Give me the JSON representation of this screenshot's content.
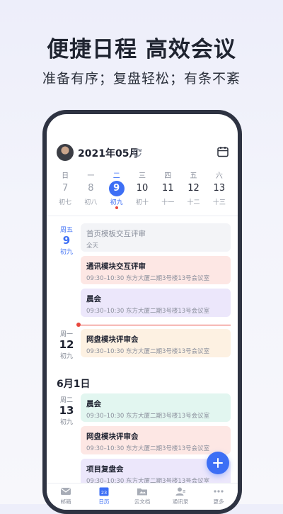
{
  "promo": {
    "headline": "便捷日程 高效会议",
    "subline": "准备有序；复盘轻松；有条不紊"
  },
  "header": {
    "month": "2021年05月"
  },
  "week": [
    {
      "weekday": "日",
      "day": "7",
      "lunar": "初七"
    },
    {
      "weekday": "一",
      "day": "8",
      "lunar": "初八"
    },
    {
      "weekday": "二",
      "day": "9",
      "lunar": "初九"
    },
    {
      "weekday": "三",
      "day": "10",
      "lunar": "初十"
    },
    {
      "weekday": "四",
      "day": "11",
      "lunar": "十一"
    },
    {
      "weekday": "五",
      "day": "12",
      "lunar": "十二"
    },
    {
      "weekday": "六",
      "day": "13",
      "lunar": "十三"
    }
  ],
  "groups": [
    {
      "weekday": "周五",
      "day": "9",
      "lunar": "初九"
    },
    {
      "weekday": "周一",
      "day": "12",
      "lunar": "初九"
    },
    {
      "weekday": "周二",
      "day": "13",
      "lunar": "初九"
    }
  ],
  "section_date": "6月1日",
  "events": [
    {
      "title": "首页模板交互评审",
      "sub": "全天"
    },
    {
      "title": "通讯模块交互评审",
      "sub": "09:30–10:30  东方大厦二期3号楼13号会议室"
    },
    {
      "title": "晨会",
      "sub": "09:30–10:30  东方大厦二期3号楼13号会议室"
    },
    {
      "title": "网盘模块评审会",
      "sub": "09:30–10:30  东方大厦二期3号楼13号会议室"
    },
    {
      "title": "晨会",
      "sub": "09:30–10:30  东方大厦二期3号楼13号会议室"
    },
    {
      "title": "网盘模块评审会",
      "sub": "09:30–10:30  东方大厦二期3号楼13号会议室"
    },
    {
      "title": "项目复盘会",
      "sub": "09:30–10:30  东方大厦二期3号楼13号会议室"
    }
  ],
  "tabs": [
    {
      "label": "邮箱",
      "icon": "mail-icon"
    },
    {
      "label": "日历",
      "icon": "calendar-icon",
      "badge": "23"
    },
    {
      "label": "云文档",
      "icon": "folder-icon"
    },
    {
      "label": "通讯录",
      "icon": "contacts-icon"
    },
    {
      "label": "更多",
      "icon": "more-icon"
    }
  ],
  "colors": {
    "accent": "#3d6ff5",
    "today_marker": "#e8473d"
  }
}
